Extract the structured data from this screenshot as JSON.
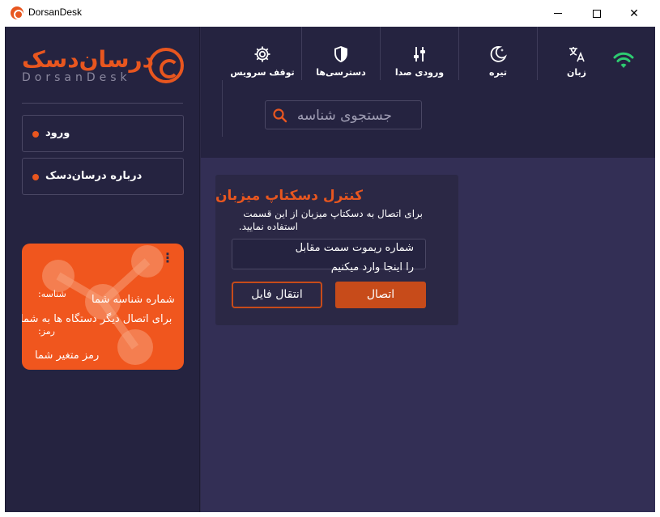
{
  "window": {
    "title": "DorsanDesk"
  },
  "brand": {
    "name_fa": "درسان‌دسک",
    "name_en": "DorsanDesk",
    "accent": "#e8561f"
  },
  "sidebar": {
    "login_label": "ورود",
    "about_label": "درباره درسان‌دسک",
    "id_card": {
      "id_label": "شناسه:",
      "id_value": "شماره شناسه شما",
      "description": "برای اتصال دیگر دستگاه ها به شما",
      "password_label": "رمز:",
      "password_value": "رمز متغیر شما"
    }
  },
  "toolbar": {
    "items": [
      {
        "icon": "wifi-icon",
        "label": ""
      },
      {
        "icon": "language-icon",
        "label": "زبان"
      },
      {
        "icon": "moon-icon",
        "label": "تیره"
      },
      {
        "icon": "audio-input-icon",
        "label": "ورودی صدا"
      },
      {
        "icon": "shield-icon",
        "label": "دسترسی‌ها"
      },
      {
        "icon": "gear-icon",
        "label": "توقف سرویس"
      }
    ],
    "status_color": "#2ecc71"
  },
  "search": {
    "placeholder": "جستجوی شناسه"
  },
  "host_control": {
    "title": "کنترل دسکتاپ میزبان",
    "description_line1": "برای اتصال به دسکتاپ میزبان از این قسمت",
    "description_line2": "استفاده نمایید.",
    "remote_input_line1": "شماره ریموت سمت مقابل",
    "remote_input_line2": "را اینجا وارد میکنیم",
    "connect_label": "اتصال",
    "file_transfer_label": "انتقال فایل"
  }
}
